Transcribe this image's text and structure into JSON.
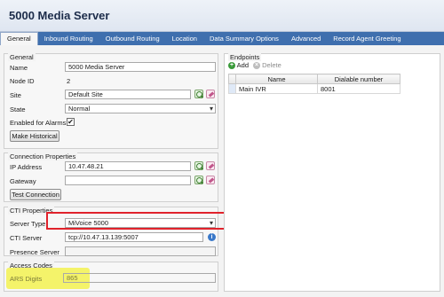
{
  "window": {
    "title": "5000 Media Server"
  },
  "tabs": [
    {
      "label": "General",
      "active": true
    },
    {
      "label": "Inbound Routing"
    },
    {
      "label": "Outbound Routing"
    },
    {
      "label": "Location"
    },
    {
      "label": "Data Summary Options"
    },
    {
      "label": "Advanced"
    },
    {
      "label": "Record Agent Greeting"
    }
  ],
  "general": {
    "title": "General",
    "name_label": "Name",
    "name_value": "5000 Media Server",
    "node_id_label": "Node ID",
    "node_id_value": "2",
    "site_label": "Site",
    "site_value": "Default Site",
    "state_label": "State",
    "state_value": "Normal",
    "alarms_label": "Enabled for Alarms",
    "alarms_checked": true,
    "check_mark": "✔",
    "make_historical_label": "Make Historical"
  },
  "connection": {
    "title": "Connection Properties",
    "ip_label": "IP Address",
    "ip_value": "10.47.48.21",
    "gateway_label": "Gateway",
    "gateway_value": "",
    "test_label": "Test Connection"
  },
  "cti": {
    "title": "CTI Properties",
    "server_type_label": "Server Type",
    "server_type_value": "MiVoice 5000",
    "cti_server_label": "CTI Server",
    "cti_server_value": "tcp://10.47.13.139:5007",
    "presence_label": "Presence Server",
    "presence_value": "",
    "info_glyph": "i"
  },
  "access": {
    "title": "Access Codes",
    "ars_label": "ARS Digits",
    "ars_value": "865"
  },
  "endpoints": {
    "title": "Endpoints",
    "add_label": "Add",
    "delete_label": "Delete",
    "add_glyph": "+",
    "delete_glyph": "×",
    "columns": [
      "Name",
      "Dialable number"
    ],
    "rows": [
      {
        "name": "Main IVR",
        "number": "8001"
      }
    ]
  },
  "colors": {
    "tab_bar": "#3f6fae",
    "red_highlight": "#e0222b",
    "yellow_highlight": "#f4f36a"
  }
}
